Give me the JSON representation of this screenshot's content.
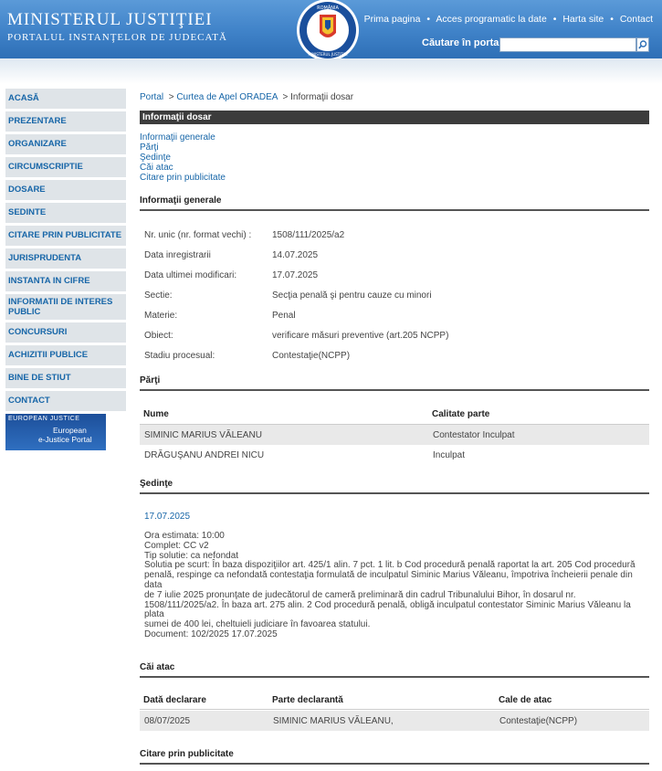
{
  "header": {
    "title": "MINISTERUL JUSTIŢIEI",
    "subtitle": "PORTALUL INSTANŢELOR DE JUDECATĂ",
    "seal_text_top": "ROMÂNIA",
    "seal_text_bottom": "MINISTERUL JUSTIŢIEI",
    "links": [
      "Prima pagina",
      "Acces programatic la date",
      "Harta site",
      "Contact"
    ],
    "search_label": "Căutare în portal",
    "search_value": ""
  },
  "sidebar": {
    "items": [
      "ACASĂ",
      "PREZENTARE",
      "ORGANIZARE",
      "CIRCUMSCRIPTIE",
      "DOSARE",
      "SEDINTE",
      "CITARE PRIN PUBLICITATE",
      "JURISPRUDENTA",
      "INSTANTA IN CIFRE",
      "INFORMATII DE INTERES PUBLIC",
      "CONCURSURI",
      "ACHIZITII PUBLICE",
      "BINE DE STIUT",
      "CONTACT"
    ],
    "banner_logo": "EUROPEAN JUSTICE",
    "banner_line1": "European",
    "banner_line2": "e-Justice Portal"
  },
  "breadcrumb": {
    "portal": "Portal",
    "court": "Curtea de Apel ORADEA",
    "current": "Informaţii dosar",
    "sep": ">"
  },
  "main": {
    "section_title": "Informaţii dosar",
    "anchors": [
      "Informaţii generale",
      "Părţi",
      "Şedinţe",
      "Căi atac",
      "Citare prin publicitate"
    ]
  },
  "general": {
    "heading": "Informaţii generale",
    "rows": [
      {
        "label": "Nr. unic (nr. format vechi) :",
        "value": "1508/111/2025/a2"
      },
      {
        "label": "Data inregistrarii",
        "value": "14.07.2025"
      },
      {
        "label": "Data ultimei modificari:",
        "value": "17.07.2025"
      },
      {
        "label": "Sectie:",
        "value": "Secţia penală şi pentru cauze cu minori"
      },
      {
        "label": "Materie:",
        "value": "Penal"
      },
      {
        "label": "Obiect:",
        "value": "verificare măsuri preventive (art.205 NCPP)"
      },
      {
        "label": "Stadiu procesual:",
        "value": "Contestaţie(NCPP)"
      }
    ]
  },
  "parti": {
    "heading": "Părţi",
    "columns": [
      "Nume",
      "Calitate parte"
    ],
    "rows": [
      [
        "SIMINIC MARIUS VĂLEANU",
        "Contestator Inculpat"
      ],
      [
        "DRĂGUŞANU ANDREI NICU",
        "Inculpat"
      ]
    ]
  },
  "sedinte": {
    "heading": "Şedinţe",
    "date": "17.07.2025",
    "lines": [
      "Ora estimata: 10:00",
      "Complet: CC v2",
      "Tip solutie: ca nefondat",
      "Solutia pe scurt: În baza dispoziţiilor art. 425/1 alin. 7 pct. 1 lit. b Cod procedură penală raportat la art. 205 Cod procedură",
      "penală, respinge ca nefondată contestaţia formulată de inculpatul Siminic Marius Văleanu, împotriva încheierii penale din data",
      "de 7 iulie 2025 pronunţate de judecătorul de cameră preliminară din cadrul Tribunalului Bihor, în dosarul nr.",
      "1508/111/2025/a2. În baza art. 275 alin. 2 Cod procedură penală, obligă inculpatul contestator Siminic Marius Văleanu la plata",
      "sumei de 400 lei, cheltuieli judiciare în favoarea statului.",
      "Document:   102/2025  17.07.2025"
    ]
  },
  "cai_atac": {
    "heading": "Căi atac",
    "columns": [
      "Dată declarare",
      "Parte declarantă",
      "Cale de atac"
    ],
    "rows": [
      [
        "08/07/2025",
        "SIMINIC MARIUS VĂLEANU,",
        "Contestaţie(NCPP)"
      ]
    ]
  },
  "citare": {
    "heading": "Citare prin publicitate"
  }
}
